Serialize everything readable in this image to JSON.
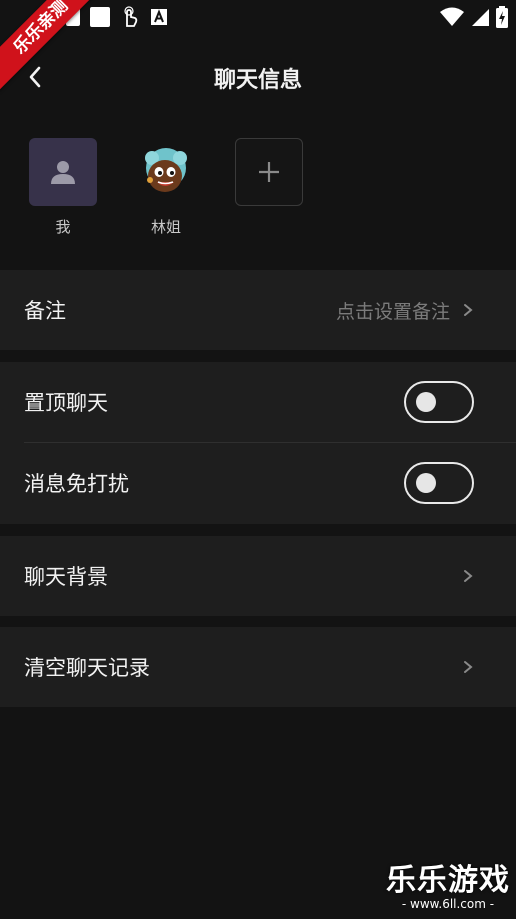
{
  "status_bar": {
    "icons": [
      "notification-square-icon",
      "notification-square-icon",
      "touch-hand-icon",
      "app-a-icon",
      "wifi-icon",
      "signal-icon",
      "battery-charging-icon"
    ]
  },
  "watermark_corner": "乐乐亲测",
  "header": {
    "title": "聊天信息",
    "back_icon": "chevron-left-icon"
  },
  "members": [
    {
      "name": "我",
      "avatar": "default-user-icon"
    },
    {
      "name": "林姐",
      "avatar": "cartoon-avatar"
    }
  ],
  "add_member_icon": "plus-icon",
  "remark": {
    "label": "备注",
    "value": "点击设置备注"
  },
  "pin_chat": {
    "label": "置顶聊天",
    "on": false
  },
  "mute": {
    "label": "消息免打扰",
    "on": false
  },
  "background": {
    "label": "聊天背景"
  },
  "clear": {
    "label": "清空聊天记录"
  },
  "watermark": {
    "main": "乐乐游戏",
    "sub": "- www.6ll.com -"
  },
  "colors": {
    "background": "#131313",
    "row_bg": "#1e1e1e",
    "accent_red": "#d0121b"
  }
}
